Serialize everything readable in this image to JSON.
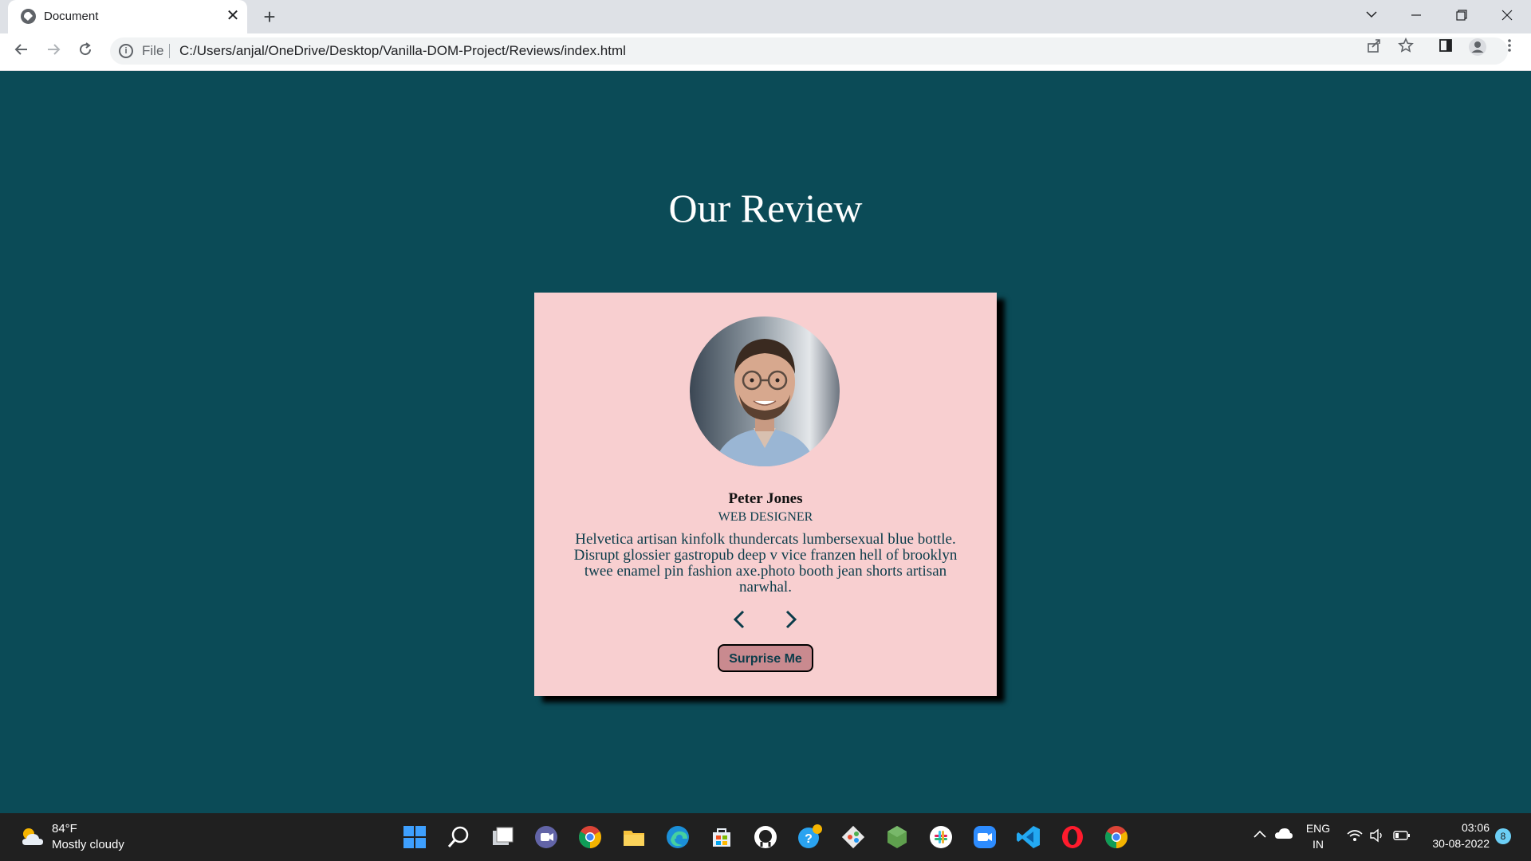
{
  "browser": {
    "tab_title": "Document",
    "new_tab_symbol": "+",
    "address_scheme": "File",
    "address_url": "C:/Users/anjal/OneDrive/Desktop/Vanilla-DOM-Project/Reviews/index.html",
    "icons": [
      "globe-icon",
      "close-icon",
      "new-tab-icon",
      "chevron-down-icon",
      "minimize-icon",
      "restore-icon",
      "window-close-icon",
      "back-icon",
      "forward-icon",
      "reload-icon",
      "info-icon",
      "share-icon",
      "star-icon",
      "side-panel-icon",
      "profile-icon",
      "menu-icon"
    ]
  },
  "page": {
    "title": "Our Review",
    "colors": {
      "background": "#0b4b57",
      "card": "#f8cfd0",
      "button": "#c98a8f",
      "text": "#0b3c4a"
    }
  },
  "review": {
    "name": "Peter Jones",
    "job": "WEB DESIGNER",
    "text": "Helvetica artisan kinfolk thundercats lumbersexual blue bottle. Disrupt glossier gastropub deep v vice franzen hell of brooklyn twee enamel pin fashion axe.photo booth jean shorts artisan narwhal.",
    "surprise_label": "Surprise Me"
  },
  "taskbar": {
    "weather_temp": "84°F",
    "weather_condition": "Mostly cloudy",
    "lang_line1": "ENG",
    "lang_line2": "IN",
    "time": "03:06",
    "date": "30-08-2022",
    "notification_count": "8",
    "apps": [
      "windows-start",
      "search",
      "task-view",
      "teams-chat",
      "chrome",
      "file-explorer",
      "edge",
      "microsoft-store",
      "github",
      "help",
      "git",
      "nodejs",
      "slack",
      "zoom",
      "vscode",
      "opera",
      "chrome-active"
    ]
  }
}
